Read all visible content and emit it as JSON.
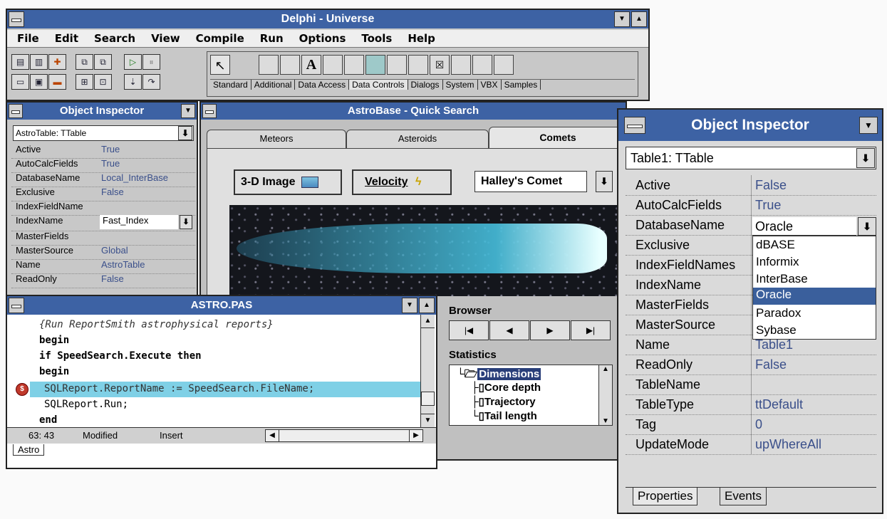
{
  "main_window": {
    "title": "Delphi - Universe",
    "menu": [
      "File",
      "Edit",
      "Search",
      "View",
      "Compile",
      "Run",
      "Options",
      "Tools",
      "Help"
    ],
    "palette_tabs": [
      "Standard",
      "Additional",
      "Data Access",
      "Data Controls",
      "Dialogs",
      "System",
      "VBX",
      "Samples"
    ]
  },
  "left_inspector": {
    "title": "Object Inspector",
    "selector": "AstroTable: TTable",
    "props": [
      {
        "name": "Active",
        "value": "True"
      },
      {
        "name": "AutoCalcFields",
        "value": "True"
      },
      {
        "name": "DatabaseName",
        "value": "Local_InterBase"
      },
      {
        "name": "Exclusive",
        "value": "False"
      },
      {
        "name": "IndexFieldName",
        "value": ""
      },
      {
        "name": "IndexName",
        "value": "Fast_Index"
      },
      {
        "name": "MasterFields",
        "value": ""
      },
      {
        "name": "MasterSource",
        "value": "Global"
      },
      {
        "name": "Name",
        "value": "AstroTable"
      },
      {
        "name": "ReadOnly",
        "value": "False"
      }
    ]
  },
  "astrobase": {
    "title": "AstroBase - Quick Search",
    "tabs": [
      "Meteors",
      "Asteroids",
      "Comets"
    ],
    "button_3d": "3-D Image",
    "button_velocity": "Velocity",
    "comet_combo": "Halley's Comet",
    "browser_label": "Browser",
    "browser_buttons": [
      "|◀",
      "◀",
      "▶",
      "▶|"
    ],
    "statistics_label": "Statistics",
    "tree": [
      "Dimensions",
      "Core depth",
      "Trajectory",
      "Tail length"
    ]
  },
  "editor": {
    "title": "ASTRO.PAS",
    "lines": [
      "{Run ReportSmith astrophysical reports}",
      "begin",
      "if SpeedSearch.Execute then",
      "begin",
      "SQLReport.ReportName := SpeedSearch.FileName;",
      "SQLReport.Run;",
      "end"
    ],
    "status": {
      "position": "63: 43",
      "state": "Modified",
      "mode": "Insert"
    },
    "tab": "Astro"
  },
  "right_inspector": {
    "title": "Object Inspector",
    "selector": "Table1: TTable",
    "props": [
      {
        "name": "Active",
        "value": "False"
      },
      {
        "name": "AutoCalcFields",
        "value": "True"
      },
      {
        "name": "DatabaseName",
        "value": "Oracle"
      },
      {
        "name": "Exclusive",
        "value": ""
      },
      {
        "name": "IndexFieldNames",
        "value": ""
      },
      {
        "name": "IndexName",
        "value": ""
      },
      {
        "name": "MasterFields",
        "value": ""
      },
      {
        "name": "MasterSource",
        "value": ""
      },
      {
        "name": "Name",
        "value": "Table1"
      },
      {
        "name": "ReadOnly",
        "value": "False"
      },
      {
        "name": "TableName",
        "value": ""
      },
      {
        "name": "TableType",
        "value": "ttDefault"
      },
      {
        "name": "Tag",
        "value": "0"
      },
      {
        "name": "UpdateMode",
        "value": "upWhereAll"
      }
    ],
    "db_options": [
      "dBASE",
      "Informix",
      "InterBase",
      "Oracle",
      "Paradox",
      "Sybase"
    ],
    "selected_option": "Oracle",
    "bottom_tabs": [
      "Properties",
      "Events"
    ]
  },
  "colors": {
    "titlebar": "#3d62a4",
    "selection": "#3a5f9c",
    "highlight_line": "#7fd0e6"
  }
}
